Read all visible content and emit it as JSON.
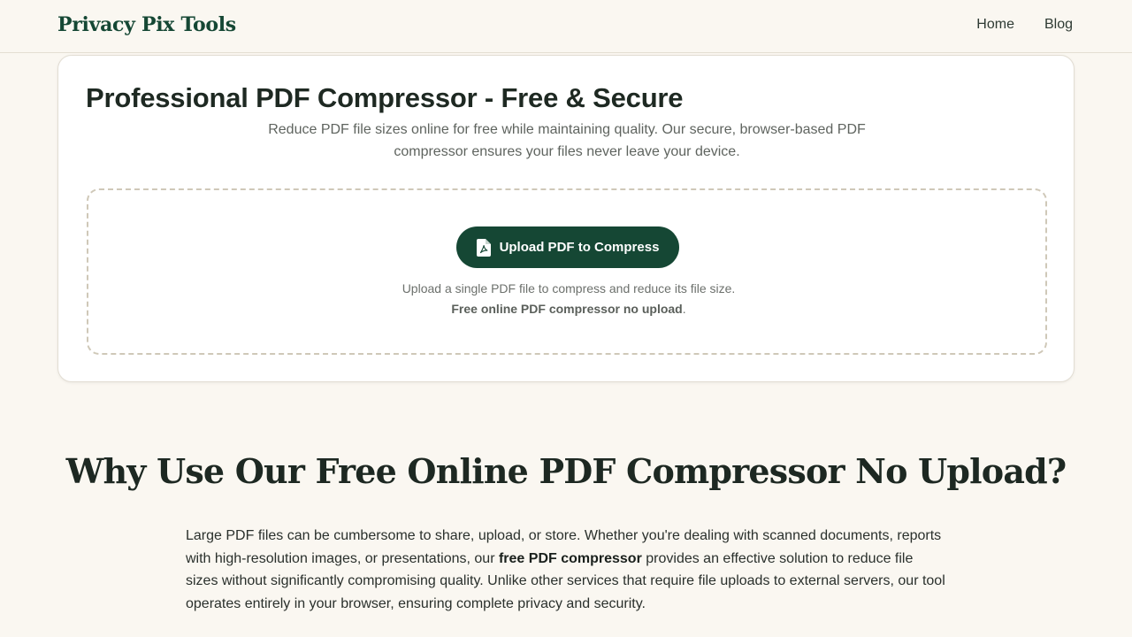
{
  "header": {
    "brand": "Privacy Pix Tools",
    "nav": [
      {
        "label": "Home"
      },
      {
        "label": "Blog"
      }
    ]
  },
  "tool": {
    "title": "Professional PDF Compressor - Free & Secure",
    "description": "Reduce PDF file sizes online for free while maintaining quality. Our secure, browser-based PDF compressor ensures your files never leave your device.",
    "upload_button": "Upload PDF to Compress",
    "upload_icon": "pdf-file-icon",
    "hint_text": "Upload a single PDF file to compress and reduce its file size. ",
    "hint_bold": "Free online PDF compressor no upload",
    "hint_end": "."
  },
  "why": {
    "title": "Why Use Our Free Online PDF Compressor No Upload?",
    "body_1": "Large PDF files can be cumbersome to share, upload, or store. Whether you're dealing with scanned documents, reports with high-resolution images, or presentations, our ",
    "body_bold": "free PDF compressor",
    "body_2": " provides an effective solution to reduce file sizes without significantly compromising quality. Unlike other services that require file uploads to external servers, our tool operates entirely in your browser, ensuring complete privacy and security."
  },
  "colors": {
    "brand_green": "#154734",
    "background": "#faf7f1",
    "card": "#ffffff"
  }
}
